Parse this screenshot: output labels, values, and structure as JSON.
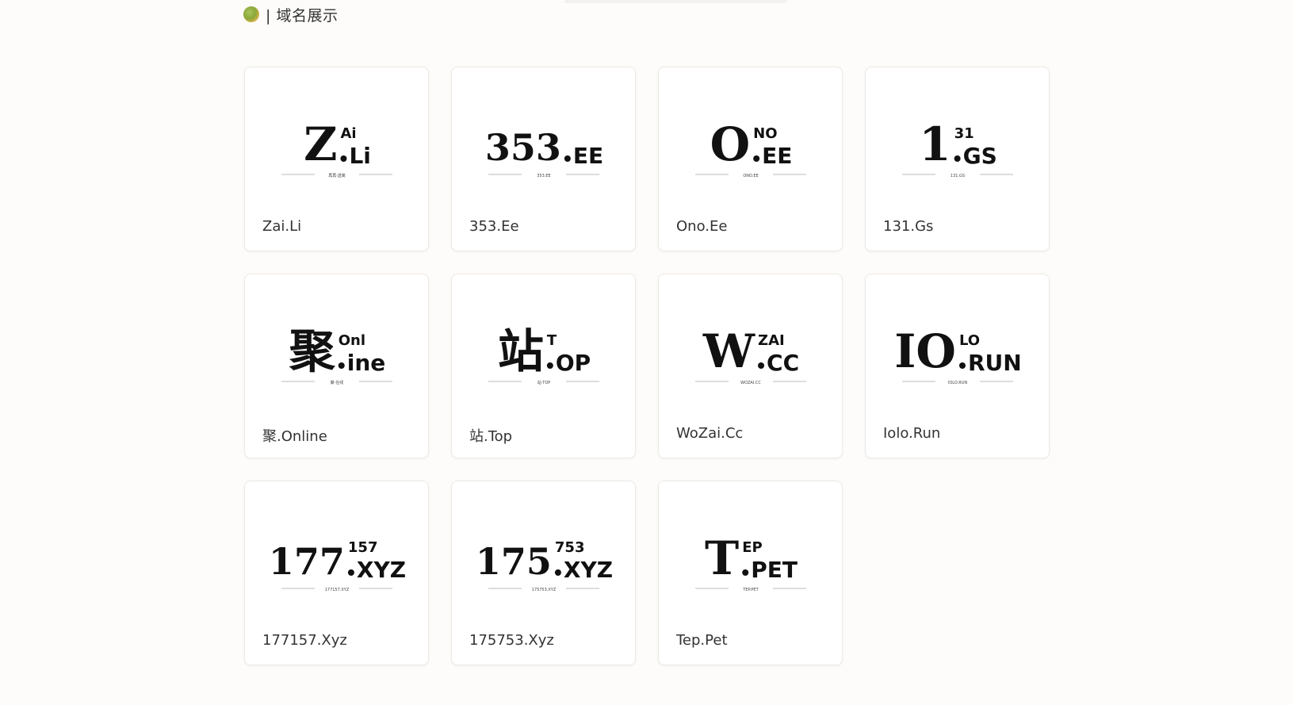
{
  "header": {
    "title": "| 域名展示",
    "icon": "logo-icon"
  },
  "domains": [
    {
      "name": "Zai.Li",
      "main": "Z",
      "sup": "Ai",
      "tail": "Li",
      "caption": "再再·送离"
    },
    {
      "name": "353.Ee",
      "main": "353",
      "sup": "",
      "tail": "EE",
      "caption": "353.EE"
    },
    {
      "name": "Ono.Ee",
      "main": "O",
      "sup": "NO",
      "tail": "EE",
      "caption": "ONO.EE"
    },
    {
      "name": "131.Gs",
      "main": "1",
      "sup": "31",
      "tail": "GS",
      "caption": "131.GS"
    },
    {
      "name": "聚.Online",
      "main": "聚",
      "sup": "Onl",
      "tail": "ine",
      "caption": "聚·在线"
    },
    {
      "name": "站.Top",
      "main": "站",
      "sup": "T",
      "tail": "OP",
      "caption": "站·TOP"
    },
    {
      "name": "WoZai.Cc",
      "main": "W",
      "sup": "ZAI",
      "tail": "CC",
      "caption": "WOZAI.CC"
    },
    {
      "name": "Iolo.Run",
      "main": "IO",
      "sup": "LO",
      "tail": "RUN",
      "caption": "IOLO.RUN"
    },
    {
      "name": "177157.Xyz",
      "main": "177",
      "sup": "157",
      "tail": "XYZ",
      "caption": "177157.XYZ"
    },
    {
      "name": "175753.Xyz",
      "main": "175",
      "sup": "753",
      "tail": "XYZ",
      "caption": "175753.XYZ"
    },
    {
      "name": "Tep.Pet",
      "main": "T",
      "sup": "EP",
      "tail": "PET",
      "caption": "TEP.PET"
    }
  ]
}
